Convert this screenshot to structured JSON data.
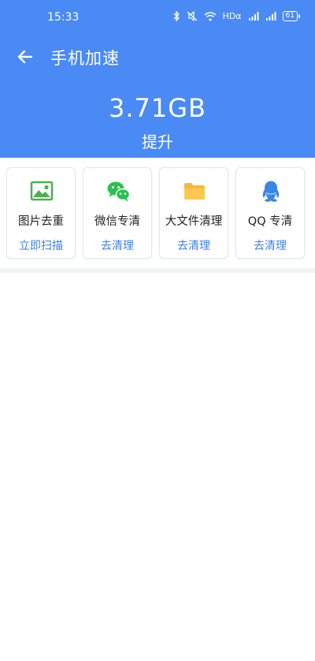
{
  "status_bar": {
    "time": "15:33",
    "network_label": "HDα",
    "battery": "61"
  },
  "header": {
    "back_icon": "arrow-left-icon",
    "title": "手机加速",
    "amount": "3.71GB",
    "subtitle": "提升",
    "background_color": "#4a8af4"
  },
  "tools": [
    {
      "name": "图片去重",
      "action": "立即扫描",
      "icon": "image-icon"
    },
    {
      "name": "微信专清",
      "action": "去清理",
      "icon": "wechat-icon"
    },
    {
      "name": "大文件清理",
      "action": "去清理",
      "icon": "folder-icon"
    },
    {
      "name": "QQ 专清",
      "action": "去清理",
      "icon": "qq-icon"
    }
  ],
  "accent_color": "#3e7fe0"
}
